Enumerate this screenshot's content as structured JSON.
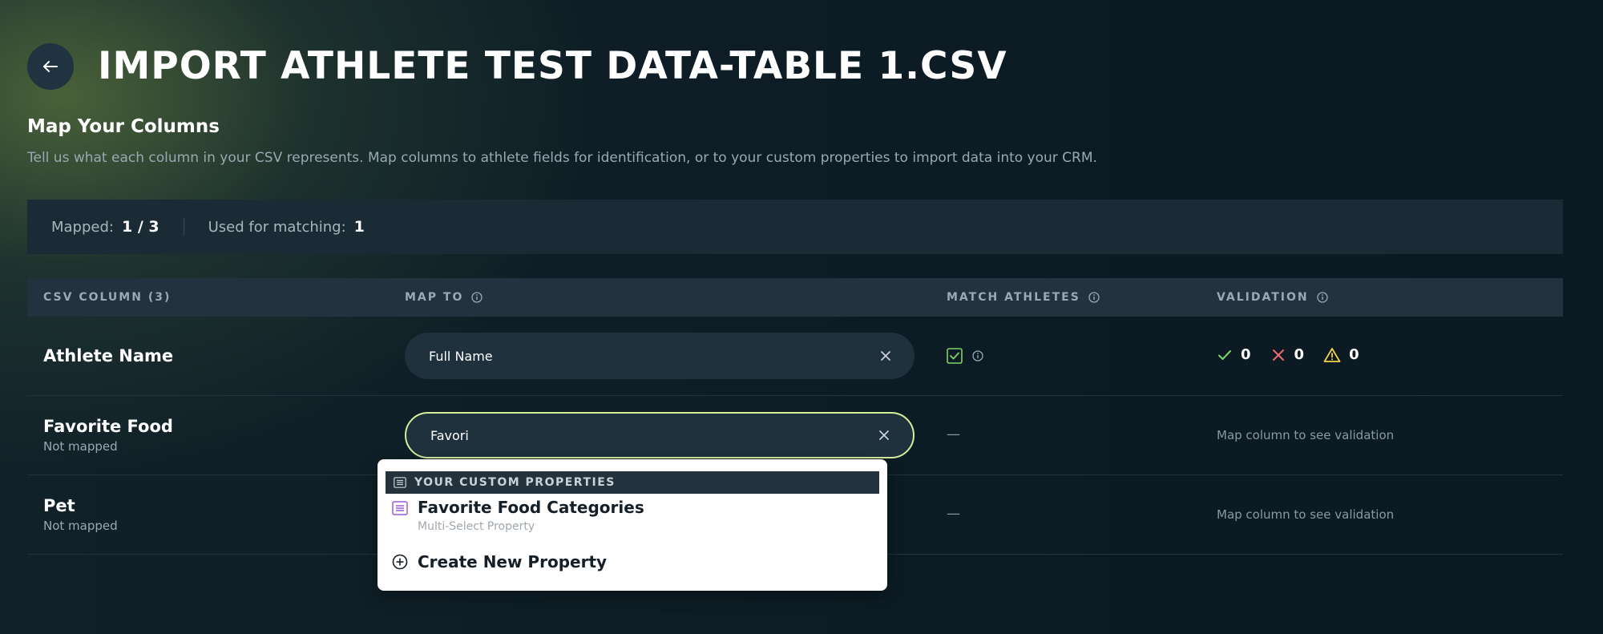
{
  "header": {
    "title": "IMPORT ATHLETE TEST DATA-TABLE 1.CSV"
  },
  "section": {
    "title": "Map Your Columns",
    "description": "Tell us what each column in your CSV represents. Map columns to athlete fields for identification, or to your custom properties to import data into your CRM."
  },
  "summary": {
    "mapped_label": "Mapped:",
    "mapped_value": "1 / 3",
    "matching_label": "Used for matching:",
    "matching_value": "1"
  },
  "table": {
    "headers": {
      "csv_column": "CSV COLUMN (3)",
      "map_to": "MAP TO",
      "match_athletes": "MATCH ATHLETES",
      "validation": "VALIDATION"
    },
    "rows": [
      {
        "name": "Athlete Name",
        "status": "",
        "map_value": "Full Name",
        "match_checked": true,
        "validation": {
          "valid": "0",
          "invalid": "0",
          "warning": "0"
        }
      },
      {
        "name": "Favorite Food",
        "status": "Not mapped",
        "map_value": "Favori",
        "match_placeholder": "—",
        "validation_hint": "Map column to see validation"
      },
      {
        "name": "Pet",
        "status": "Not mapped",
        "map_value": "",
        "match_placeholder": "—",
        "validation_hint": "Map column to see validation"
      }
    ]
  },
  "dropdown": {
    "group_label": "YOUR CUSTOM PROPERTIES",
    "option_title": "Favorite Food Categories",
    "option_subtitle": "Multi-Select Property",
    "create_label": "Create New Property"
  },
  "colors": {
    "background": "#0c1b24",
    "accent_green": "#d6ef9a",
    "valid": "#7fd36a",
    "invalid": "#ef6b6b",
    "warning": "#f1d24a",
    "property_icon": "#9b59d8"
  },
  "icons": {
    "back": "arrow-left-icon",
    "info": "info-icon",
    "clear": "close-icon",
    "checkbox": "checkbox-checked-icon",
    "valid": "check-icon",
    "invalid": "x-icon",
    "warning": "warning-icon",
    "list": "list-icon",
    "add": "plus-circle-icon"
  }
}
